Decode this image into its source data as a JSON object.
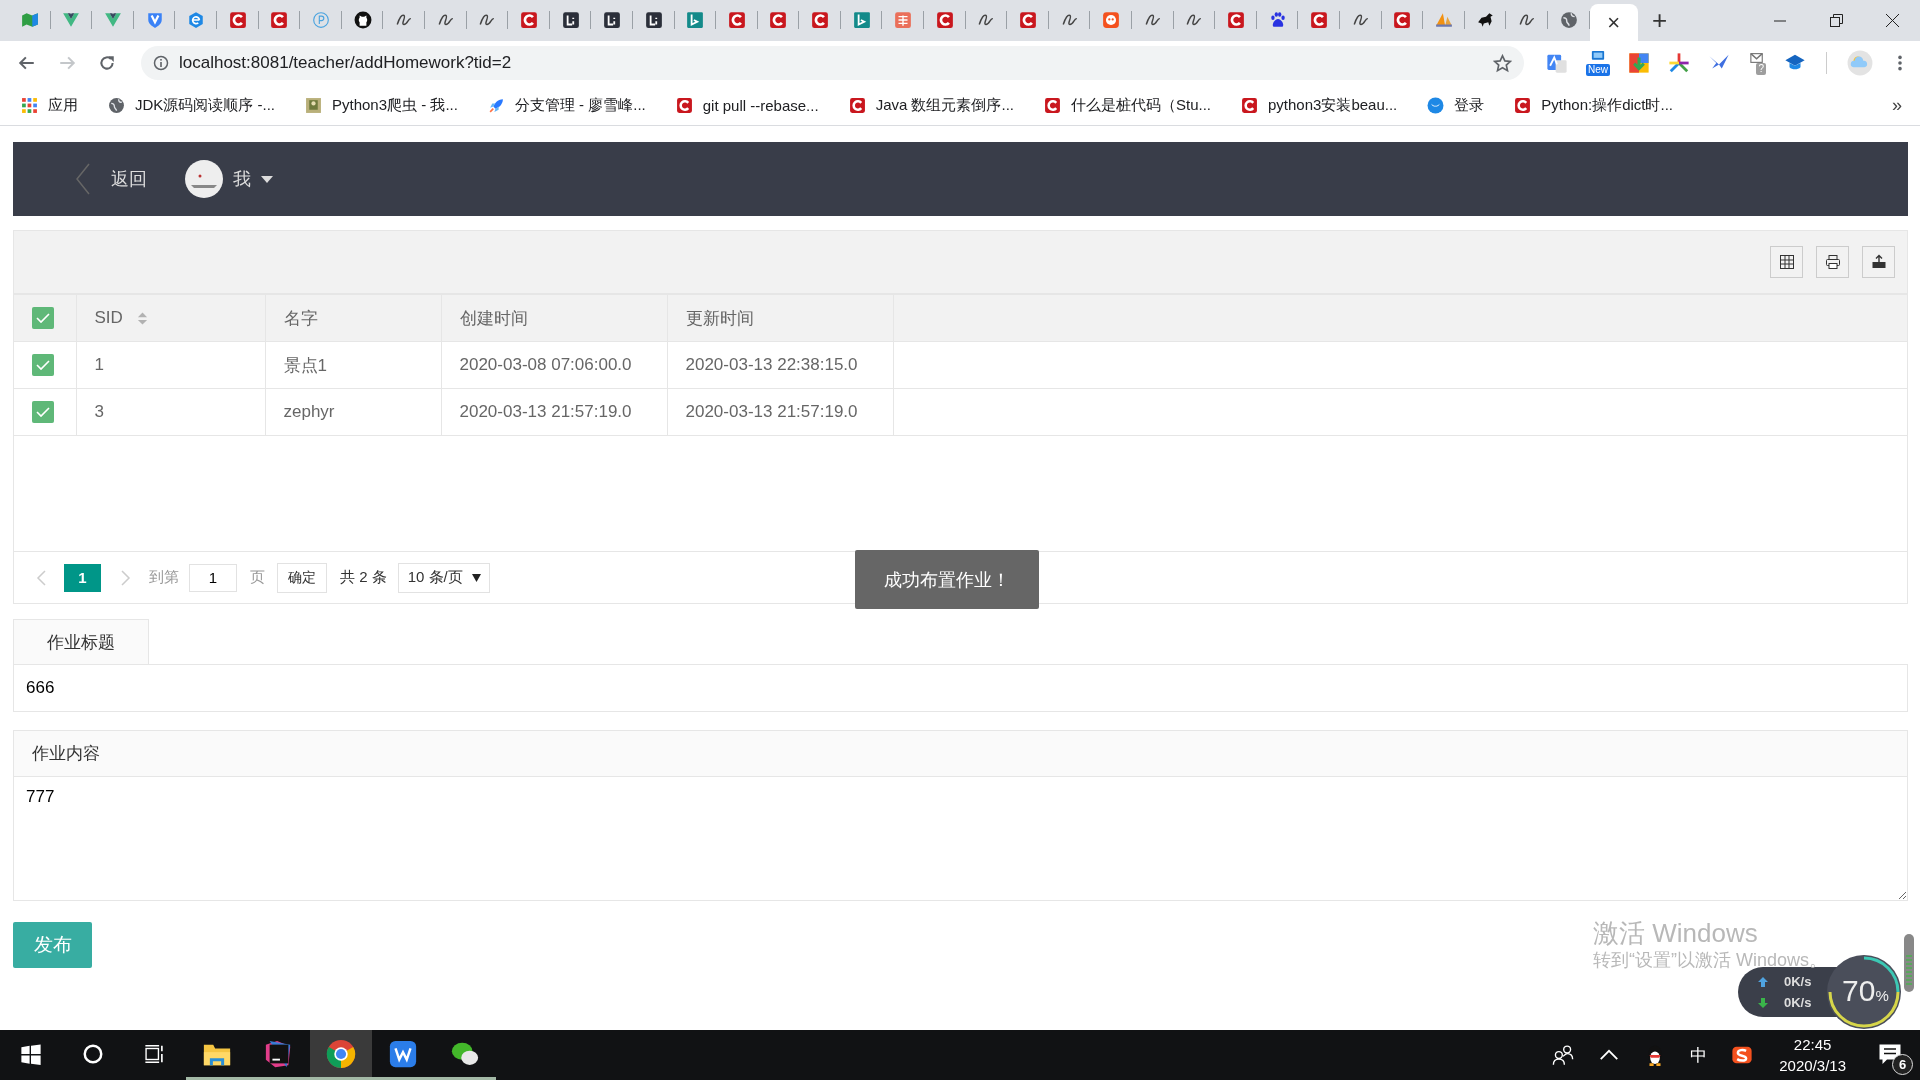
{
  "browser": {
    "tabs": [
      {
        "kind": "map",
        "selected": false
      },
      {
        "kind": "vue",
        "selected": false
      },
      {
        "kind": "vue",
        "selected": false
      },
      {
        "kind": "shield",
        "selected": false
      },
      {
        "kind": "hex",
        "selected": false
      },
      {
        "kind": "csdn",
        "selected": false
      },
      {
        "kind": "csdn",
        "selected": false
      },
      {
        "kind": "pcircle",
        "selected": false
      },
      {
        "kind": "github",
        "selected": false
      },
      {
        "kind": "scribble",
        "selected": false
      },
      {
        "kind": "scribble",
        "selected": false
      },
      {
        "kind": "scribble",
        "selected": false
      },
      {
        "kind": "csdn",
        "selected": false
      },
      {
        "kind": "leet",
        "selected": false
      },
      {
        "kind": "leet",
        "selected": false
      },
      {
        "kind": "leet",
        "selected": false
      },
      {
        "kind": "bing",
        "selected": false
      },
      {
        "kind": "csdn",
        "selected": false
      },
      {
        "kind": "csdn",
        "selected": false
      },
      {
        "kind": "csdn",
        "selected": false
      },
      {
        "kind": "bing",
        "selected": false
      },
      {
        "kind": "jian",
        "selected": false
      },
      {
        "kind": "csdn",
        "selected": false
      },
      {
        "kind": "scribble",
        "selected": false
      },
      {
        "kind": "csdn",
        "selected": false
      },
      {
        "kind": "scribble",
        "selected": false
      },
      {
        "kind": "face",
        "selected": false
      },
      {
        "kind": "scribble",
        "selected": false
      },
      {
        "kind": "scribble",
        "selected": false
      },
      {
        "kind": "csdn",
        "selected": false
      },
      {
        "kind": "baidu",
        "selected": false
      },
      {
        "kind": "csdn",
        "selected": false
      },
      {
        "kind": "scribble",
        "selected": false
      },
      {
        "kind": "csdn",
        "selected": false
      },
      {
        "kind": "pma",
        "selected": false
      },
      {
        "kind": "horse",
        "selected": false
      },
      {
        "kind": "scribble",
        "selected": false
      },
      {
        "kind": "globe",
        "selected": false
      },
      {
        "kind": "none",
        "selected": true,
        "close": "×"
      }
    ],
    "new_tab": "+",
    "window_controls": [
      {
        "kind": "minimize"
      },
      {
        "kind": "restore"
      },
      {
        "kind": "close"
      }
    ],
    "address": {
      "url": "localhost:8081/teacher/addHomework?tid=2",
      "forward_disabled": true
    },
    "extensions": [
      {
        "kind": "translate"
      },
      {
        "kind": "screen",
        "badge": "New"
      },
      {
        "kind": "download"
      },
      {
        "kind": "tree"
      },
      {
        "kind": "swallow"
      },
      {
        "kind": "mail",
        "badge": "?"
      },
      {
        "kind": "cap"
      }
    ],
    "bookmarks": [
      {
        "kind": "apps",
        "label": "应用"
      },
      {
        "kind": "globe",
        "label": "JDK源码阅读顺序 -..."
      },
      {
        "kind": "photo",
        "label": "Python3爬虫 - 我..."
      },
      {
        "kind": "rocket",
        "label": "分支管理 - 廖雪峰..."
      },
      {
        "kind": "csdn",
        "label": "git pull --rebase..."
      },
      {
        "kind": "csdn",
        "label": "Java 数组元素倒序..."
      },
      {
        "kind": "csdn",
        "label": "什么是桩代码（Stu..."
      },
      {
        "kind": "csdn",
        "label": "python3安装beau..."
      },
      {
        "kind": "bird",
        "label": "登录"
      },
      {
        "kind": "csdn",
        "label": "Python:操作dict时..."
      }
    ],
    "more_bookmarks": "»"
  },
  "page": {
    "header": {
      "back": "返回",
      "user": "我"
    },
    "table": {
      "tools": [
        {
          "kind": "columns"
        },
        {
          "kind": "print"
        },
        {
          "kind": "export"
        }
      ],
      "all_checked": true,
      "columns": [
        {
          "label": "SID",
          "sortable": true
        },
        {
          "label": "名字",
          "sortable": false
        },
        {
          "label": "创建时间",
          "sortable": false
        },
        {
          "label": "更新时间",
          "sortable": false
        }
      ],
      "rows": [
        {
          "checked": true,
          "cells": [
            "1",
            "景点1",
            "2020-03-08 07:06:00.0",
            "2020-03-13 22:38:15.0"
          ]
        },
        {
          "checked": true,
          "cells": [
            "3",
            "zephyr",
            "2020-03-13 21:57:19.0",
            "2020-03-13 21:57:19.0"
          ]
        }
      ]
    },
    "pagination": {
      "prev_disabled": true,
      "next_disabled": true,
      "pages": [
        {
          "label": "1",
          "selected": true
        }
      ],
      "goto_label": "到第",
      "goto_value": "1",
      "page_unit": "页",
      "confirm": "确定",
      "total": "共 2 条",
      "page_size": "10 条/页"
    },
    "toast": "成功布置作业！",
    "title_field": {
      "label": "作业标题",
      "value": "666"
    },
    "content_field": {
      "label": "作业内容",
      "value": "777"
    },
    "submit": "发布"
  },
  "desktop": {
    "activation": {
      "title": "激活 Windows",
      "hint": "转到“设置”以激活 Windows。"
    },
    "net_widget": {
      "upload": "0K/s",
      "download": "0K/s",
      "percent": "70",
      "unit": "%"
    }
  },
  "taskbar": {
    "apps": [
      {
        "kind": "start",
        "running": false,
        "active": false
      },
      {
        "kind": "search",
        "running": false,
        "active": false
      },
      {
        "kind": "taskview",
        "running": false,
        "active": false
      },
      {
        "kind": "explorer",
        "running": true,
        "active": false
      },
      {
        "kind": "ide",
        "running": true,
        "active": false
      },
      {
        "kind": "chrome",
        "running": true,
        "active": true
      },
      {
        "kind": "wps",
        "running": true,
        "active": false
      },
      {
        "kind": "wechat",
        "running": true,
        "active": false
      }
    ],
    "tray": [
      {
        "kind": "people"
      },
      {
        "kind": "chevron"
      },
      {
        "kind": "penguin"
      },
      {
        "kind": "ime",
        "label": "中"
      },
      {
        "kind": "sogou"
      }
    ],
    "time": "22:45",
    "date": "2020/3/13",
    "notifications": "6"
  }
}
